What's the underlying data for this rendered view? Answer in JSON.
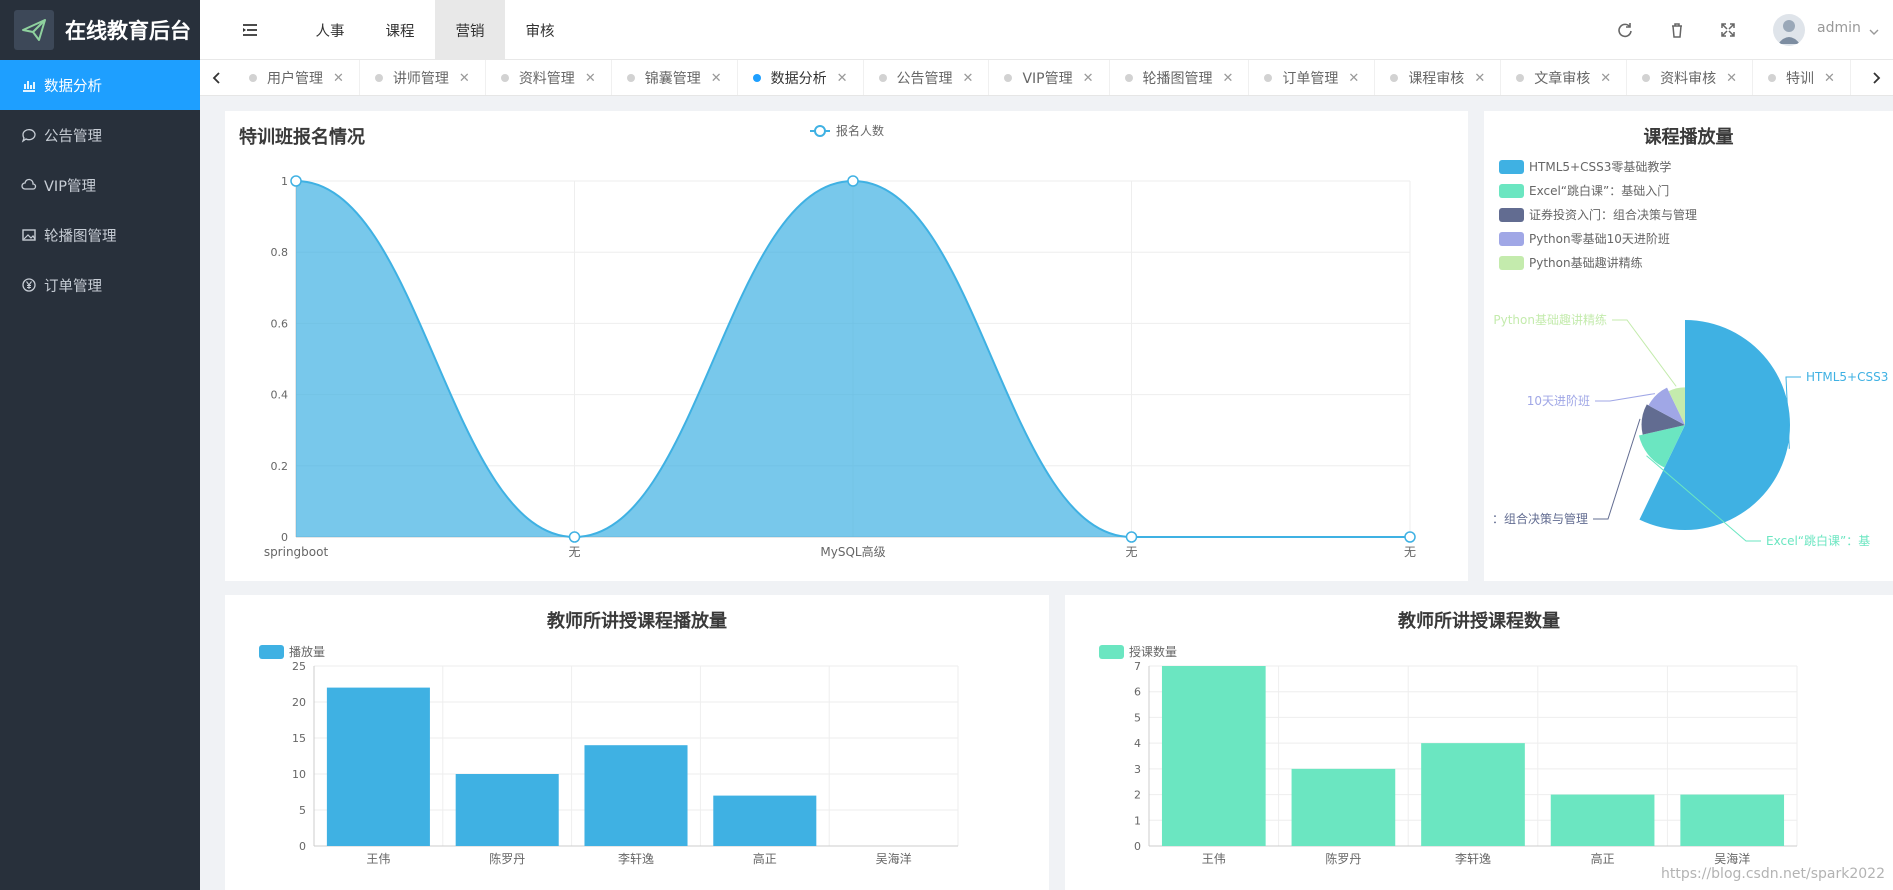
{
  "app": {
    "title": "在线教育后台"
  },
  "sidebar": {
    "items": [
      {
        "label": "数据分析",
        "icon": "bar-chart-icon",
        "active": true
      },
      {
        "label": "公告管理",
        "icon": "chat-icon",
        "active": false
      },
      {
        "label": "VIP管理",
        "icon": "cloud-icon",
        "active": false
      },
      {
        "label": "轮播图管理",
        "icon": "picture-icon",
        "active": false
      },
      {
        "label": "订单管理",
        "icon": "yen-icon",
        "active": false
      }
    ]
  },
  "topnav": {
    "items": [
      "人事",
      "课程",
      "营销",
      "审核"
    ],
    "active": "营销"
  },
  "user": {
    "name": "admin"
  },
  "tabs": [
    "用户管理",
    "讲师管理",
    "资料管理",
    "锦囊管理",
    "数据分析",
    "公告管理",
    "VIP管理",
    "轮播图管理",
    "订单管理",
    "课程审核",
    "文章审核",
    "资料审核",
    "特训"
  ],
  "active_tab": "数据分析",
  "watermark": "https://blog.csdn.net/spark2022",
  "colors": {
    "accent": "#1e9fff",
    "sidebar": "#28303b",
    "bar1": "#3fb1e3",
    "bar2": "#6be6c1"
  },
  "chart_data": [
    {
      "type": "area",
      "title": "特训班报名情况",
      "legend": "报名人数",
      "categories": [
        "springboot",
        "无",
        "MySQL高级",
        "无",
        "无"
      ],
      "values": [
        1,
        0,
        1,
        0,
        0
      ],
      "ylim": [
        0,
        1
      ],
      "yticks": [
        "0",
        "0.2",
        "0.4",
        "0.6",
        "0.8",
        "1"
      ],
      "color": "#3fb1e3"
    },
    {
      "type": "pie",
      "title": "课程播放量",
      "legend": [
        "HTML5+CSS3零基础教学",
        "Excel“跳白课”：基础入门",
        "证券投资入门：组合决策与管理",
        "Python零基础10天进阶班",
        "Python基础趣讲精练"
      ],
      "values": [
        40,
        10,
        8,
        7,
        5
      ],
      "colors": [
        "#3fb1e3",
        "#6be6c1",
        "#626c91",
        "#a0a7e6",
        "#c4ebad"
      ],
      "labels": [
        "HTML5+CSS3",
        "Excel“跳白课”：基",
        "：组合决策与管理",
        "10天进阶班",
        "Python基础趣讲精练"
      ]
    },
    {
      "type": "bar",
      "title": "教师所讲授课程播放量",
      "legend": "播放量",
      "categories": [
        "王伟",
        "陈罗丹",
        "李轩逸",
        "高正",
        "吴海洋"
      ],
      "values": [
        22,
        10,
        14,
        7,
        0
      ],
      "ylim": [
        0,
        25
      ],
      "yticks": [
        "0",
        "5",
        "10",
        "15",
        "20",
        "25"
      ],
      "color": "#3fb1e3"
    },
    {
      "type": "bar",
      "title": "教师所讲授课程数量",
      "legend": "授课数量",
      "categories": [
        "王伟",
        "陈罗丹",
        "李轩逸",
        "高正",
        "吴海洋"
      ],
      "values": [
        7,
        3,
        4,
        2,
        2
      ],
      "ylim": [
        0,
        7
      ],
      "yticks": [
        "0",
        "1",
        "2",
        "3",
        "4",
        "5",
        "6",
        "7"
      ],
      "color": "#6be6c1"
    }
  ]
}
